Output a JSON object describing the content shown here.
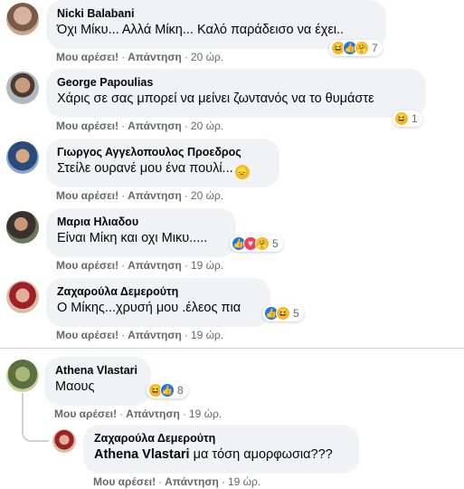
{
  "comments": [
    {
      "name": "Nicki Balabani",
      "text": "Όχι Μίκυ... Αλλά Μίκη... Καλό παράδεισο να έχει..",
      "like": "Μου αρέσει!",
      "reply": "Απάντηση",
      "time": "20 ώρ.",
      "react_count": "7"
    },
    {
      "name": "George Papoulias",
      "text": "Χάρις σε σας μπορεί να μείνει ζωντανός να το θυμάστε",
      "like": "Μου αρέσει!",
      "reply": "Απάντηση",
      "time": "20 ώρ.",
      "react_count": "1"
    },
    {
      "name": "Γιωργος Αγγελοπουλος Προεδρος",
      "text": "Στείλε ουρανέ μου ένα πουλί...",
      "like": "Μου αρέσει!",
      "reply": "Απάντηση",
      "time": "20 ώρ."
    },
    {
      "name": "Μαρια Ηλιαδου",
      "text": "Είναι Μίκη και οχι Μικυ.....",
      "like": "Μου αρέσει!",
      "reply": "Απάντηση",
      "time": "19 ώρ.",
      "react_count": "5"
    },
    {
      "name": "Ζαχαρούλα Δεμερούτη",
      "text": "Ο Μίκης...χρυσή μου .έλεος πια",
      "like": "Μου αρέσει!",
      "reply": "Απάντηση",
      "time": "19 ώρ.",
      "react_count": "5"
    },
    {
      "name": "Athena Vlastari",
      "text": "Μαους",
      "like": "Μου αρέσει!",
      "reply": "Απάντηση",
      "time": "19 ώρ.",
      "react_count": "8"
    }
  ],
  "reply": {
    "name": "Ζαχαρούλα Δεμερούτη",
    "tag": "Athena Vlastari",
    "text": " μα τόση αμορφωσια???",
    "like": "Μου αρέσει!",
    "reply": "Απάντηση",
    "time": "19 ώρ."
  },
  "icons": {
    "like": "like-reaction-icon",
    "haha": "haha-reaction-icon",
    "love": "love-reaction-icon",
    "care": "care-reaction-icon",
    "sad": "sad-emoji-icon"
  },
  "colors": {
    "bubble": "#f0f2f5",
    "meta": "#65676b",
    "like": "#1877f2",
    "emoji": "#f7b928",
    "love": "#f33e58"
  }
}
